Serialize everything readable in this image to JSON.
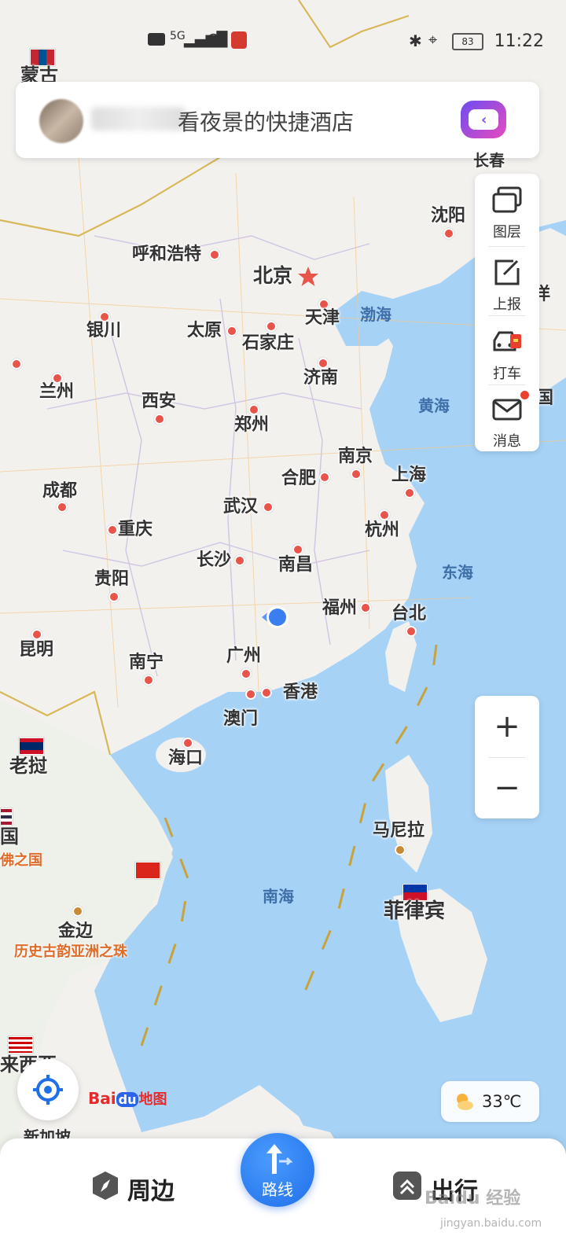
{
  "status_bar": {
    "hd": "HD",
    "network": "5G",
    "battery": "83",
    "time": "11:22"
  },
  "search": {
    "text": "看夜景的快捷酒店",
    "assistant_icon": "voice-assistant-icon"
  },
  "tools": [
    {
      "label": "图层",
      "icon": "layers-icon"
    },
    {
      "label": "上报",
      "icon": "report-edit-icon"
    },
    {
      "label": "打车",
      "icon": "taxi-icon"
    },
    {
      "label": "消息",
      "icon": "mail-icon"
    }
  ],
  "zoom": {
    "in": "+",
    "out": "−"
  },
  "map": {
    "cities": {
      "beijing": "北京",
      "tianjin": "天津",
      "shijiazhuang": "石家庄",
      "taiyuan": "太原",
      "hohhot": "呼和浩特",
      "yinchuan": "银川",
      "lanzhou": "兰州",
      "xian": "西安",
      "zhengzhou": "郑州",
      "jinan": "济南",
      "nanjing": "南京",
      "hefei": "合肥",
      "shanghai": "上海",
      "hangzhou": "杭州",
      "wuhan": "武汉",
      "chengdu": "成都",
      "chongqing": "重庆",
      "changsha": "长沙",
      "nanchang": "南昌",
      "guiyang": "贵阳",
      "fuzhou": "福州",
      "taipei": "台北",
      "kunming": "昆明",
      "nanning": "南宁",
      "guangzhou": "广州",
      "hongkong": "香港",
      "macau": "澳门",
      "haikou": "海口",
      "shenyang": "沈阳",
      "changchun": "长春",
      "manila": "马尼拉",
      "phnompenh": "金边"
    },
    "seas": {
      "bohai": "渤海",
      "huanghai": "黄海",
      "donghai": "东海",
      "nanhai": "南海"
    },
    "countries": {
      "mongolia": "蒙古",
      "laos": "老挝",
      "thailand": "国",
      "philippines": "菲律宾",
      "malaysia": "来西亚",
      "singapore": "新加坡"
    },
    "taglines": {
      "thailand": "佛之国",
      "cambodia": "历史古韵亚洲之珠"
    },
    "edge_labels": {
      "korea": "国",
      "japan": "律宾",
      "right_edge": "洋"
    }
  },
  "weather": {
    "temp": "33℃"
  },
  "logo": {
    "b1": "Bai",
    "b2": "du",
    "b3": "地图"
  },
  "bottom_nav": {
    "nearby": "周边",
    "route": "路线",
    "travel": "出行"
  },
  "watermark": {
    "text": "Baidu 经验",
    "url": "jingyan.baidu.com"
  },
  "colors": {
    "sea": "#a6d2f6",
    "land": "#f3f1ee",
    "accent_blue": "#1f6fe8",
    "city_dot": "#e8534a"
  }
}
